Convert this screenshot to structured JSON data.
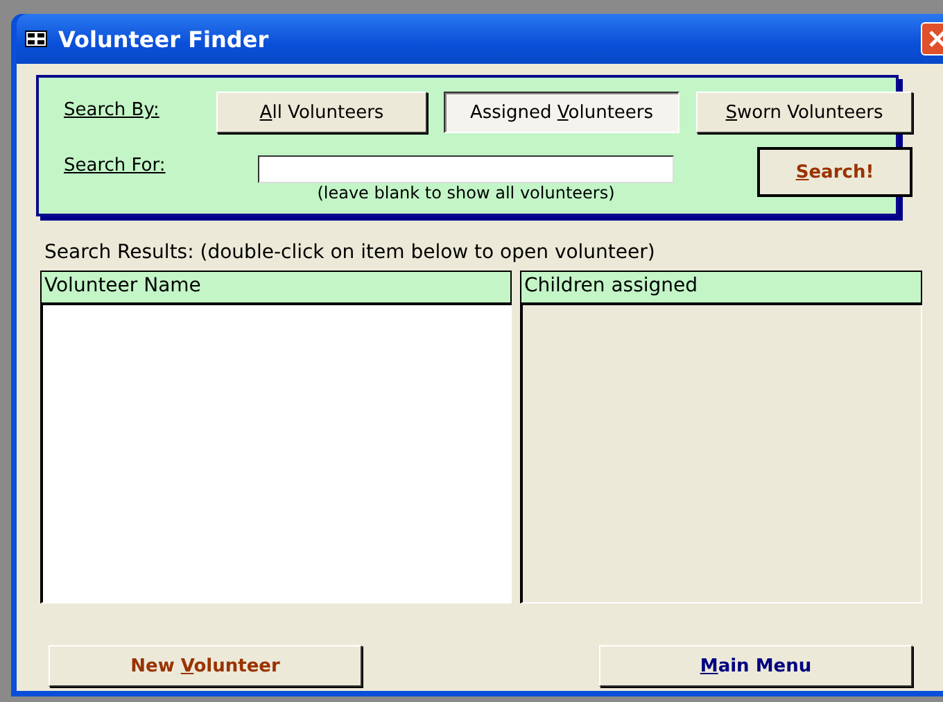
{
  "window": {
    "title": "Volunteer Finder"
  },
  "search_by": {
    "label": "Search By:",
    "options": [
      {
        "label": {
          "key": "A",
          "after": "ll Volunteers"
        },
        "selected": false
      },
      {
        "label": {
          "before": "Assigned ",
          "key": "V",
          "after": "olunteers"
        },
        "selected": true
      },
      {
        "label": {
          "key": "S",
          "after": "worn Volunteers"
        },
        "selected": false
      }
    ]
  },
  "search_for": {
    "label": "Search For:",
    "hint": "(leave blank to show all volunteers)"
  },
  "search_button": {
    "label": {
      "key": "S",
      "after": "earch!"
    }
  },
  "results": {
    "caption": "Search Results: (double-click on item below to open volunteer)",
    "columns": [
      "Volunteer Name",
      "Children assigned"
    ]
  },
  "buttons": [
    {
      "label": {
        "before": "New ",
        "key": "V",
        "after": "olunteer"
      },
      "kind": "primary"
    },
    {
      "label": {
        "key": "M",
        "after": "ain Menu"
      },
      "kind": "nav"
    }
  ]
}
